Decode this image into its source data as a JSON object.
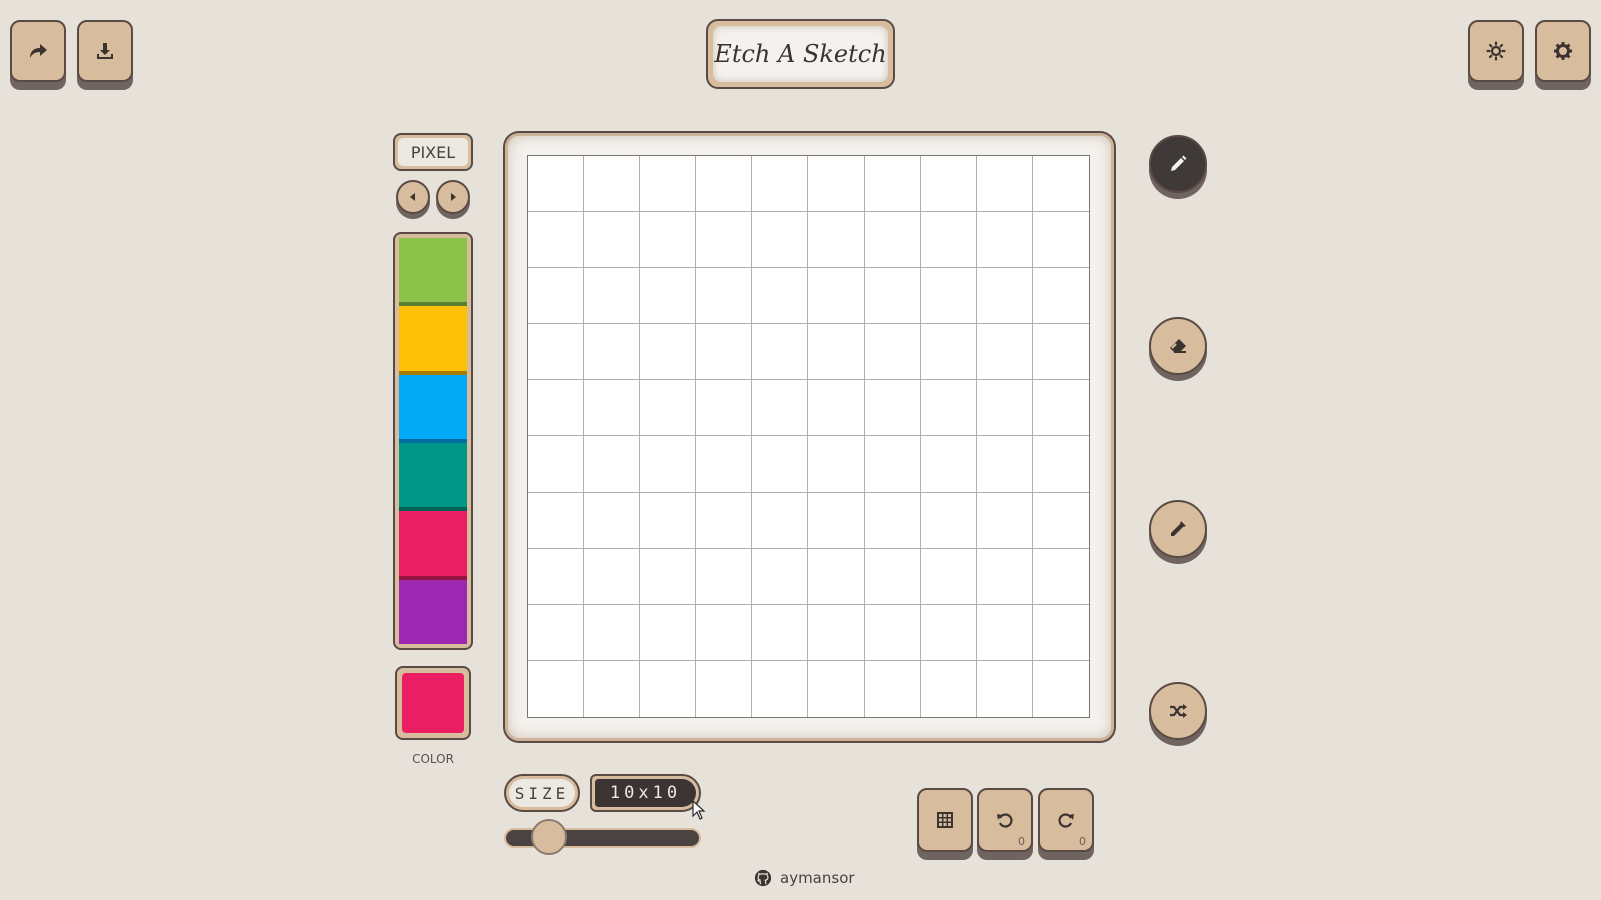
{
  "header": {
    "title": "Etch A Sketch",
    "left_buttons": [
      {
        "name": "share-button",
        "icon": "share-icon"
      },
      {
        "name": "download-button",
        "icon": "download-icon"
      }
    ],
    "right_buttons": [
      {
        "name": "theme-button",
        "icon": "sun-icon"
      },
      {
        "name": "settings-button",
        "icon": "gear-icon"
      }
    ]
  },
  "palette": {
    "mode_label": "PIXEL",
    "prev_icon": "caret-left-icon",
    "next_icon": "caret-right-icon",
    "swatches": [
      "#8bc34a",
      "#ffc107",
      "#03a9f4",
      "#009688",
      "#e91e63",
      "#9c27b0"
    ],
    "current_color": "#e91e63",
    "color_label": "COLOR"
  },
  "board": {
    "rows": 10,
    "cols": 10,
    "background": "#ffffff"
  },
  "tools": [
    {
      "name": "pen-tool",
      "icon": "pencil-icon",
      "active": true
    },
    {
      "name": "eraser-tool",
      "icon": "eraser-icon",
      "active": false
    },
    {
      "name": "eyedropper-tool",
      "icon": "eyedropper-icon",
      "active": false
    },
    {
      "name": "random-tool",
      "icon": "shuffle-icon",
      "active": false
    }
  ],
  "size": {
    "label": "SIZE",
    "value": "10x10",
    "slider_min": 1,
    "slider_max": 100,
    "slider_value": 10
  },
  "actions": {
    "grid_toggle_icon": "grid-icon",
    "undo_icon": "undo-icon",
    "undo_count": "0",
    "redo_icon": "redo-icon",
    "redo_count": "0"
  },
  "footer": {
    "icon": "github-icon",
    "username": "aymansor"
  },
  "colors": {
    "background": "#e6e2da",
    "button": "#d8bc9e",
    "dark": "#3f3937"
  }
}
